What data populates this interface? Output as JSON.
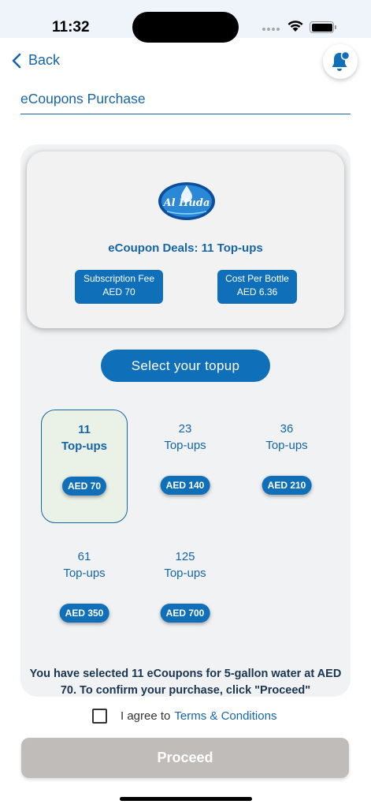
{
  "status_bar": {
    "time": "11:32"
  },
  "header": {
    "back_label": "Back"
  },
  "page": {
    "title": "eCoupons Purchase"
  },
  "deal": {
    "logo_text": "Al Huda",
    "title": "eCoupon Deals: 11 Top-ups",
    "fee_label": "Subscription Fee",
    "fee_value": "AED 70",
    "cost_label": "Cost Per Bottle",
    "cost_value": "AED 6.36"
  },
  "select_button": "Select your topup",
  "topups": [
    {
      "count": "11",
      "unit": "Top-ups",
      "price": "AED 70",
      "selected": true
    },
    {
      "count": "23",
      "unit": "Top-ups",
      "price": "AED 140",
      "selected": false
    },
    {
      "count": "36",
      "unit": "Top-ups",
      "price": "AED 210",
      "selected": false
    },
    {
      "count": "61",
      "unit": "Top-ups",
      "price": "AED 350",
      "selected": false
    },
    {
      "count": "125",
      "unit": "Top-ups",
      "price": "AED 700",
      "selected": false
    }
  ],
  "confirmation": "You have selected 11 eCoupons for 5-gallon water at AED 70. To confirm your purchase, click \"Proceed\"",
  "terms": {
    "prefix": "I agree to",
    "link": "Terms & Conditions",
    "checked": false
  },
  "proceed_button": "Proceed",
  "colors": {
    "primary": "#0f6fb8",
    "text_blue": "#1565a8",
    "selected_bg": "#eaf1e6",
    "proceed_disabled": "#bfbcba"
  },
  "icons": {
    "back": "chevron-left-icon",
    "notification": "bell-icon",
    "wifi": "wifi-icon",
    "battery": "battery-icon"
  }
}
